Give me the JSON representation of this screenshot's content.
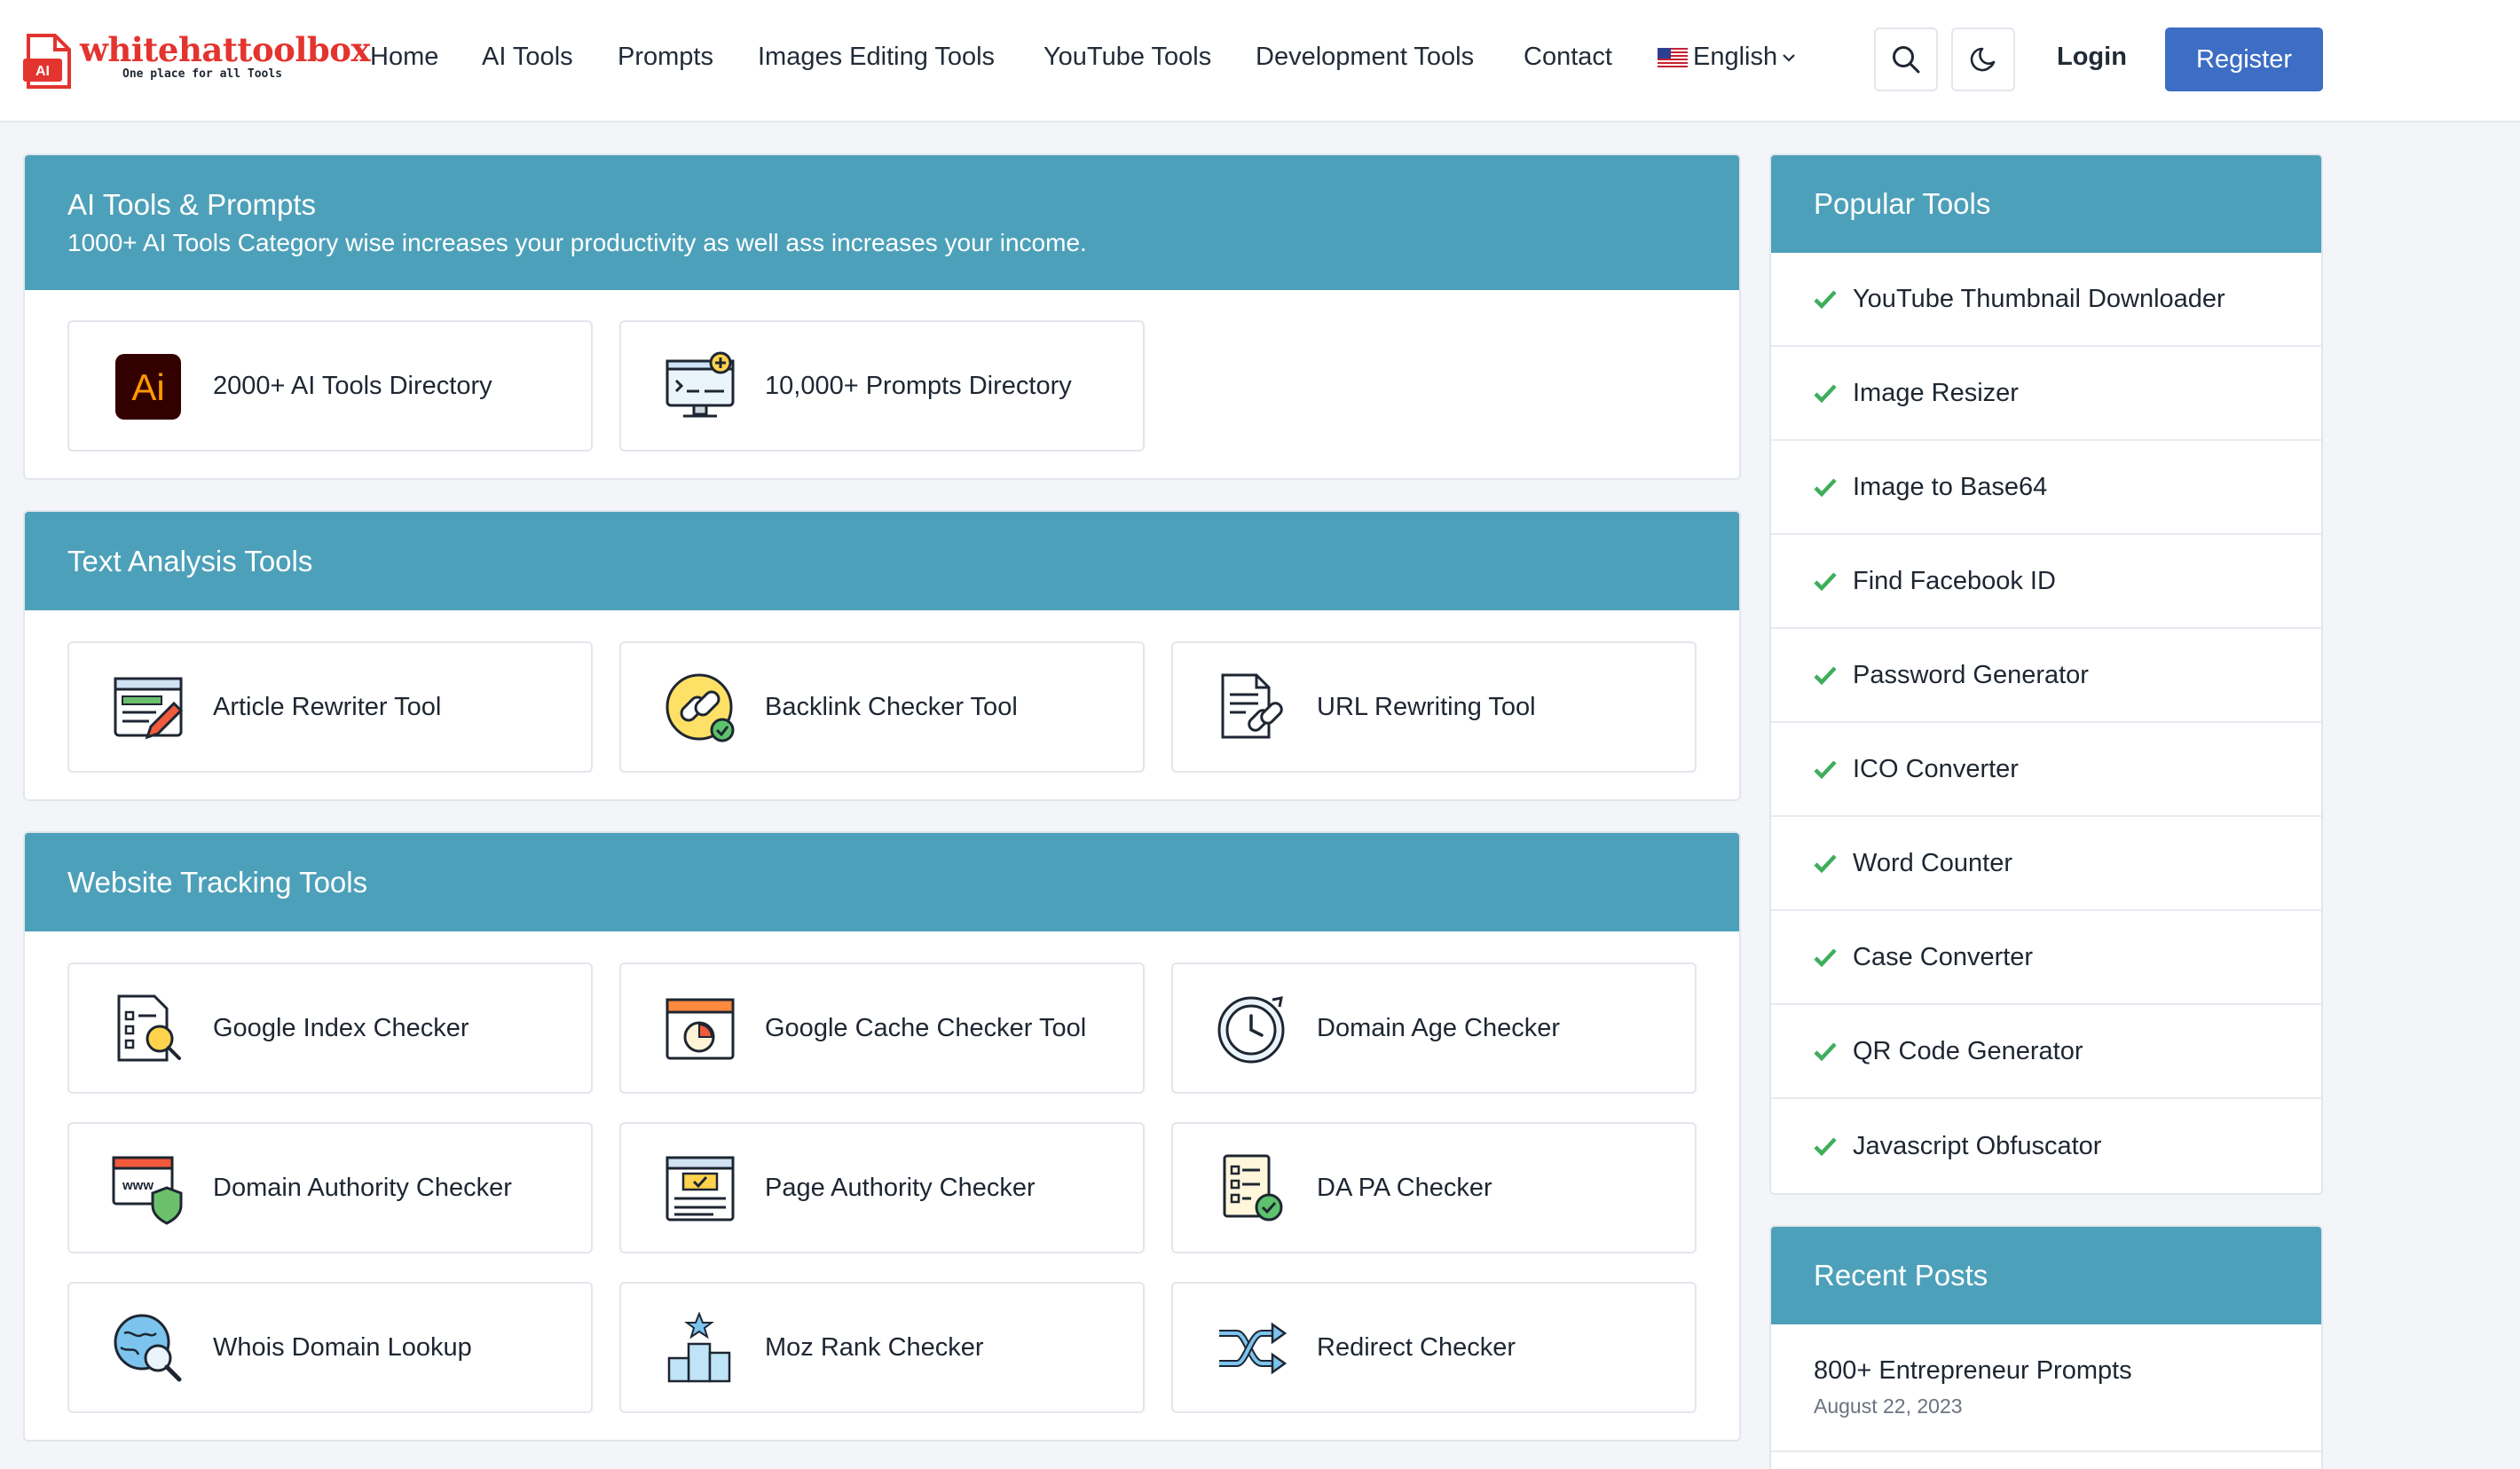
{
  "brand": {
    "name": "whitehattoolbox",
    "tagline": "One place for all Tools",
    "logo_text": "AI"
  },
  "nav": {
    "items": [
      {
        "label": "Home"
      },
      {
        "label": "AI Tools"
      },
      {
        "label": "Prompts"
      },
      {
        "label": "Images Editing Tools"
      },
      {
        "label": "YouTube Tools"
      },
      {
        "label": "Development Tools"
      },
      {
        "label": "Contact"
      }
    ],
    "language": "English",
    "login_label": "Login",
    "register_label": "Register"
  },
  "sections": [
    {
      "title": "AI Tools & Prompts",
      "subtitle": "1000+ AI Tools Category wise increases your productivity as well ass increases your income.",
      "tiles": [
        {
          "label": "2000+ AI Tools Directory",
          "icon": "ai-logo-icon",
          "icon_text": "Ai"
        },
        {
          "label": "10,000+ Prompts Directory",
          "icon": "monitor-code-icon"
        }
      ]
    },
    {
      "title": "Text Analysis Tools",
      "tiles": [
        {
          "label": "Article Rewriter Tool",
          "icon": "document-pencil-icon"
        },
        {
          "label": "Backlink Checker Tool",
          "icon": "link-check-icon"
        },
        {
          "label": "URL Rewriting Tool",
          "icon": "document-link-icon"
        }
      ]
    },
    {
      "title": "Website Tracking Tools",
      "tiles": [
        {
          "label": "Google Index Checker",
          "icon": "document-search-icon"
        },
        {
          "label": "Google Cache Checker Tool",
          "icon": "browser-gauge-icon"
        },
        {
          "label": "Domain Age Checker",
          "icon": "clock-icon"
        },
        {
          "label": "Domain Authority Checker",
          "icon": "www-shield-icon"
        },
        {
          "label": "Page Authority Checker",
          "icon": "browser-list-icon"
        },
        {
          "label": "DA PA Checker",
          "icon": "checklist-icon"
        },
        {
          "label": "Whois Domain Lookup",
          "icon": "globe-search-icon"
        },
        {
          "label": "Moz Rank Checker",
          "icon": "podium-star-icon"
        },
        {
          "label": "Redirect Checker",
          "icon": "shuffle-arrows-icon"
        }
      ]
    }
  ],
  "sidebar": {
    "popular_title": "Popular Tools",
    "popular": [
      "YouTube Thumbnail Downloader",
      "Image Resizer",
      "Image to Base64",
      "Find Facebook ID",
      "Password Generator",
      "ICO Converter",
      "Word Counter",
      "Case Converter",
      "QR Code Generator",
      "Javascript Obfuscator"
    ],
    "recent_title": "Recent Posts",
    "recent": [
      {
        "title": "800+ Entrepreneur Prompts",
        "date": "August 22, 2023"
      }
    ]
  },
  "colors": {
    "header_teal": "#4da0b9",
    "register_blue": "#3d6dc4",
    "brand_red": "#e3342f",
    "check_green": "#3fae5c"
  }
}
